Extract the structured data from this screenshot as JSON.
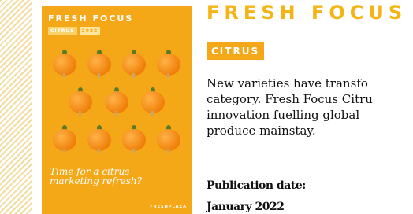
{
  "cover": {
    "title": "FRESH FOCUS",
    "badge_category": "CITRUS",
    "badge_year": "2022",
    "tagline_line1": "Time for a citrus",
    "tagline_line2": "marketing refresh?",
    "footer": "FRESHPLAZA"
  },
  "article": {
    "headline": "FRESH FOCUS",
    "category": "CITRUS",
    "description_lines": [
      "New varieties have transfo",
      "category. Fresh Focus Citru",
      "innovation fuelling global",
      "produce mainstay."
    ],
    "publication_label": "Publication date:",
    "publication_date": "January 2022"
  },
  "colors": {
    "accent": "#f5a817",
    "headline": "#f5b414",
    "orange": "#f07f0a"
  }
}
